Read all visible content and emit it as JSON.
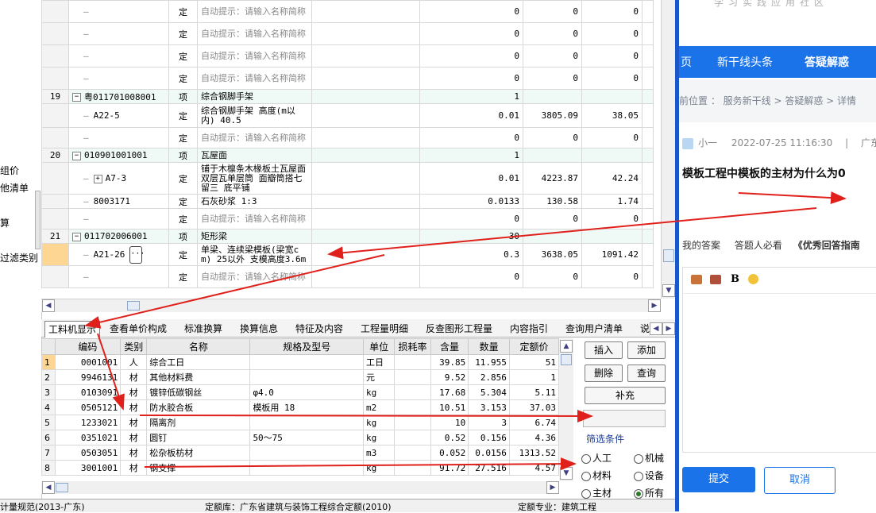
{
  "left_panel": {
    "labels": [
      "组价",
      "他清单",
      "算",
      "过滤类别"
    ]
  },
  "top_table": {
    "rows": [
      {
        "num": "",
        "code": "",
        "type": "定",
        "name": "自动提示：请输入名称简称",
        "qty": "0",
        "price": "0",
        "total": "0",
        "kind": "blank"
      },
      {
        "num": "",
        "code": "",
        "type": "定",
        "name": "自动提示：请输入名称简称",
        "qty": "0",
        "price": "0",
        "total": "0",
        "kind": "blank"
      },
      {
        "num": "",
        "code": "",
        "type": "定",
        "name": "自动提示：请输入名称简称",
        "qty": "0",
        "price": "0",
        "total": "0",
        "kind": "blank"
      },
      {
        "num": "",
        "code": "",
        "type": "定",
        "name": "自动提示：请输入名称简称",
        "qty": "0",
        "price": "0",
        "total": "0",
        "kind": "blank"
      },
      {
        "num": "19",
        "code": "粤011701008001",
        "type": "项",
        "name": "综合钢脚手架",
        "qty": "1",
        "price": "",
        "total": "",
        "kind": "parent"
      },
      {
        "num": "",
        "code": "A22-5",
        "type": "定",
        "name": "综合钢脚手架 高度(m以内) 40.5",
        "qty": "0.01",
        "price": "3805.09",
        "total": "38.05",
        "kind": "child"
      },
      {
        "num": "",
        "code": "",
        "type": "定",
        "name": "自动提示：请输入名称简称",
        "qty": "0",
        "price": "0",
        "total": "0",
        "kind": "blank"
      },
      {
        "num": "20",
        "code": "010901001001",
        "type": "项",
        "name": "瓦屋面",
        "qty": "1",
        "price": "",
        "total": "",
        "kind": "parent"
      },
      {
        "num": "",
        "code": "A7-3",
        "type": "定",
        "name": "铺于木檩条木椽板土瓦屋面 双层瓦单层筒 面瓣筒搭七留三 底平铺",
        "qty": "0.01",
        "price": "4223.87",
        "total": "42.24",
        "kind": "childplus"
      },
      {
        "num": "",
        "code": "8003171",
        "type": "定",
        "name": "石灰砂浆 1:3",
        "qty": "0.0133",
        "price": "130.58",
        "total": "1.74",
        "kind": "child"
      },
      {
        "num": "",
        "code": "",
        "type": "定",
        "name": "自动提示：请输入名称简称",
        "qty": "0",
        "price": "0",
        "total": "0",
        "kind": "blank"
      },
      {
        "num": "21",
        "code": "011702006001",
        "type": "项",
        "name": "矩形梁",
        "qty": "30",
        "price": "",
        "total": "",
        "kind": "parent"
      },
      {
        "num": "",
        "code": "A21-26",
        "type": "定",
        "name": "单梁、连续梁模板(梁宽cm) 25以外 支模高度3.6m",
        "qty": "0.3",
        "price": "3638.05",
        "total": "1091.42",
        "kind": "selected"
      },
      {
        "num": "",
        "code": "",
        "type": "定",
        "name": "自动提示：请输入名称简称",
        "qty": "0",
        "price": "0",
        "total": "0",
        "kind": "blank"
      }
    ]
  },
  "tabs": [
    "工料机显示",
    "查看单价构成",
    "标准换算",
    "换算信息",
    "特征及内容",
    "工程量明细",
    "反查图形工程量",
    "内容指引",
    "查询用户清单",
    "说"
  ],
  "material_table": {
    "headers": [
      "编码",
      "类别",
      "名称",
      "规格及型号",
      "单位",
      "损耗率",
      "含量",
      "数量",
      "定额价"
    ],
    "rows": [
      {
        "idx": "1",
        "code": "0001001",
        "cat": "人",
        "name": "综合工日",
        "spec": "",
        "unit": "工日",
        "loss": "",
        "content": "39.85",
        "qty": "11.955",
        "price": "51"
      },
      {
        "idx": "2",
        "code": "9946131",
        "cat": "材",
        "name": "其他材料费",
        "spec": "",
        "unit": "元",
        "loss": "",
        "content": "9.52",
        "qty": "2.856",
        "price": "1"
      },
      {
        "idx": "3",
        "code": "0103091",
        "cat": "材",
        "name": "镀锌低碳钢丝",
        "spec": "φ4.0",
        "unit": "kg",
        "loss": "",
        "content": "17.68",
        "qty": "5.304",
        "price": "5.11"
      },
      {
        "idx": "4",
        "code": "0505121",
        "cat": "材",
        "name": "防水胶合板",
        "spec": "模板用 18",
        "unit": "m2",
        "loss": "",
        "content": "10.51",
        "qty": "3.153",
        "price": "37.03"
      },
      {
        "idx": "5",
        "code": "1233021",
        "cat": "材",
        "name": "隔离剂",
        "spec": "",
        "unit": "kg",
        "loss": "",
        "content": "10",
        "qty": "3",
        "price": "6.74"
      },
      {
        "idx": "6",
        "code": "0351021",
        "cat": "材",
        "name": "圆钉",
        "spec": "50～75",
        "unit": "kg",
        "loss": "",
        "content": "0.52",
        "qty": "0.156",
        "price": "4.36"
      },
      {
        "idx": "7",
        "code": "0503051",
        "cat": "材",
        "name": "松杂板枋材",
        "spec": "",
        "unit": "m3",
        "loss": "",
        "content": "0.052",
        "qty": "0.0156",
        "price": "1313.52"
      },
      {
        "idx": "8",
        "code": "3001001",
        "cat": "材",
        "name": "钢支撑",
        "spec": "",
        "unit": "kg",
        "loss": "",
        "content": "91.72",
        "qty": "27.516",
        "price": "4.57"
      }
    ]
  },
  "side_buttons": {
    "insert": "插入",
    "add": "添加",
    "delete": "删除",
    "query": "查询",
    "supplement": "补充"
  },
  "filter": {
    "title": "筛选条件",
    "options": [
      "人工",
      "机械",
      "材料",
      "设备",
      "主材",
      "所有"
    ],
    "selected": "所有"
  },
  "status_bar": {
    "left": "计量规范(2013-广东)",
    "mid": "定额库：广东省建筑与装饰工程综合定额(2010)",
    "right": "定额专业：建筑工程"
  },
  "web": {
    "top_text": "学习实践应用社区",
    "nav": [
      "页",
      "新干线头条",
      "答疑解惑"
    ],
    "breadcrumb": "前位置 ： 服务新干线 > 答疑解惑 > 详情",
    "user": "小一",
    "datetime": "2022-07-25 11:16:30",
    "sep": "|",
    "location": "广东",
    "question_title": "模板工程中模板的主材为什么为0",
    "answer_tabs": [
      "我的答案",
      "答题人必看",
      "《优秀回答指南"
    ],
    "bold_label": "B",
    "submit": "提交",
    "cancel": "取消"
  },
  "colors": {
    "accent": "#1a73e8",
    "selection": "#fcd692",
    "parent_row": "#effaf6",
    "arrow": "#e0201b"
  }
}
